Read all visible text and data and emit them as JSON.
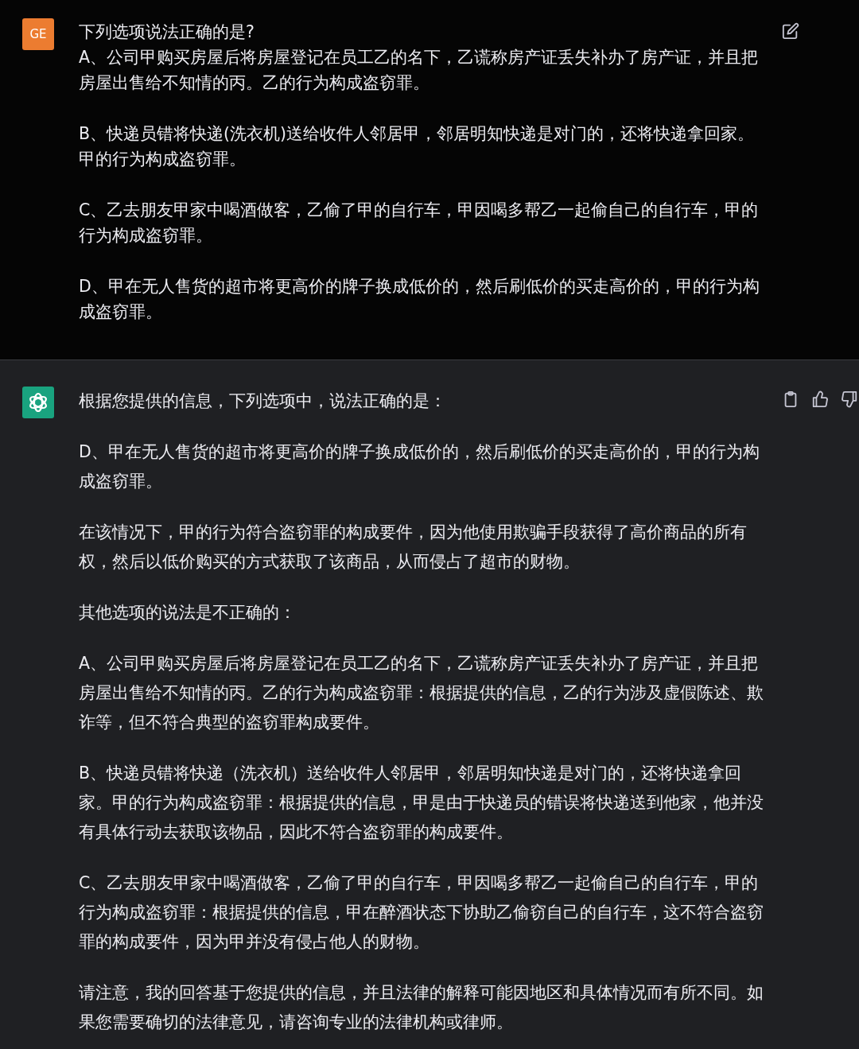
{
  "user_message": {
    "avatar": "GE",
    "paragraphs": [
      "下列选项说法正确的是?\nA、公司甲购买房屋后将房屋登记在员工乙的名下，乙谎称房产证丢失补办了房产证，并且把房屋出售给不知情的丙。乙的行为构成盗窃罪。",
      "B、快递员错将快递(洗衣机)送给收件人邻居甲，邻居明知快递是对门的，还将快递拿回家。甲的行为构成盗窃罪。",
      "C、乙去朋友甲家中喝酒做客，乙偷了甲的自行车，甲因喝多帮乙一起偷自己的自行车，甲的行为构成盗窃罪。",
      "D、甲在无人售货的超市将更高价的牌子换成低价的，然后刷低价的买走高价的，甲的行为构成盗窃罪。"
    ]
  },
  "assistant_message": {
    "paragraphs": [
      "根据您提供的信息，下列选项中，说法正确的是：",
      "D、甲在无人售货的超市将更高价的牌子换成低价的，然后刷低价的买走高价的，甲的行为构成盗窃罪。",
      "在该情况下，甲的行为符合盗窃罪的构成要件，因为他使用欺骗手段获得了高价商品的所有权，然后以低价购买的方式获取了该商品，从而侵占了超市的财物。",
      "其他选项的说法是不正确的：",
      "A、公司甲购买房屋后将房屋登记在员工乙的名下，乙谎称房产证丢失补办了房产证，并且把房屋出售给不知情的丙。乙的行为构成盗窃罪：根据提供的信息，乙的行为涉及虚假陈述、欺诈等，但不符合典型的盗窃罪构成要件。",
      "B、快递员错将快递（洗衣机）送给收件人邻居甲，邻居明知快递是对门的，还将快递拿回家。甲的行为构成盗窃罪：根据提供的信息，甲是由于快递员的错误将快递送到他家，他并没有具体行动去获取该物品，因此不符合盗窃罪的构成要件。",
      "C、乙去朋友甲家中喝酒做客，乙偷了甲的自行车，甲因喝多帮乙一起偷自己的自行车，甲的行为构成盗窃罪：根据提供的信息，甲在醉酒状态下协助乙偷窃自己的自行车，这不符合盗窃罪的构成要件，因为甲并没有侵占他人的财物。",
      "请注意，我的回答基于您提供的信息，并且法律的解释可能因地区和具体情况而有所不同。如果您需要确切的法律意见，请咨询专业的法律机构或律师。"
    ]
  }
}
